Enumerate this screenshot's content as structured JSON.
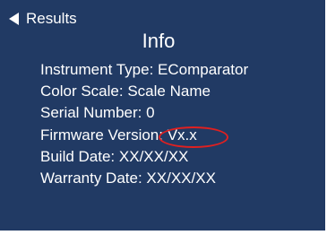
{
  "header": {
    "back_label": "Results",
    "title": "Info"
  },
  "info": {
    "rows": [
      {
        "label": "Instrument Type:",
        "value": "EComparator"
      },
      {
        "label": "Color Scale:",
        "value": "Scale Name"
      },
      {
        "label": "Serial Number:",
        "value": "0"
      },
      {
        "label": "Firmware Version:",
        "value": "Vx.x"
      },
      {
        "label": "Build Date:",
        "value": "XX/XX/XX"
      },
      {
        "label": "Warranty Date:",
        "value": "XX/XX/XX"
      }
    ]
  },
  "colors": {
    "background": "#213a64",
    "text": "#ffffff",
    "highlight": "#e02020"
  },
  "icons": {
    "back": "triangle-left-icon"
  }
}
